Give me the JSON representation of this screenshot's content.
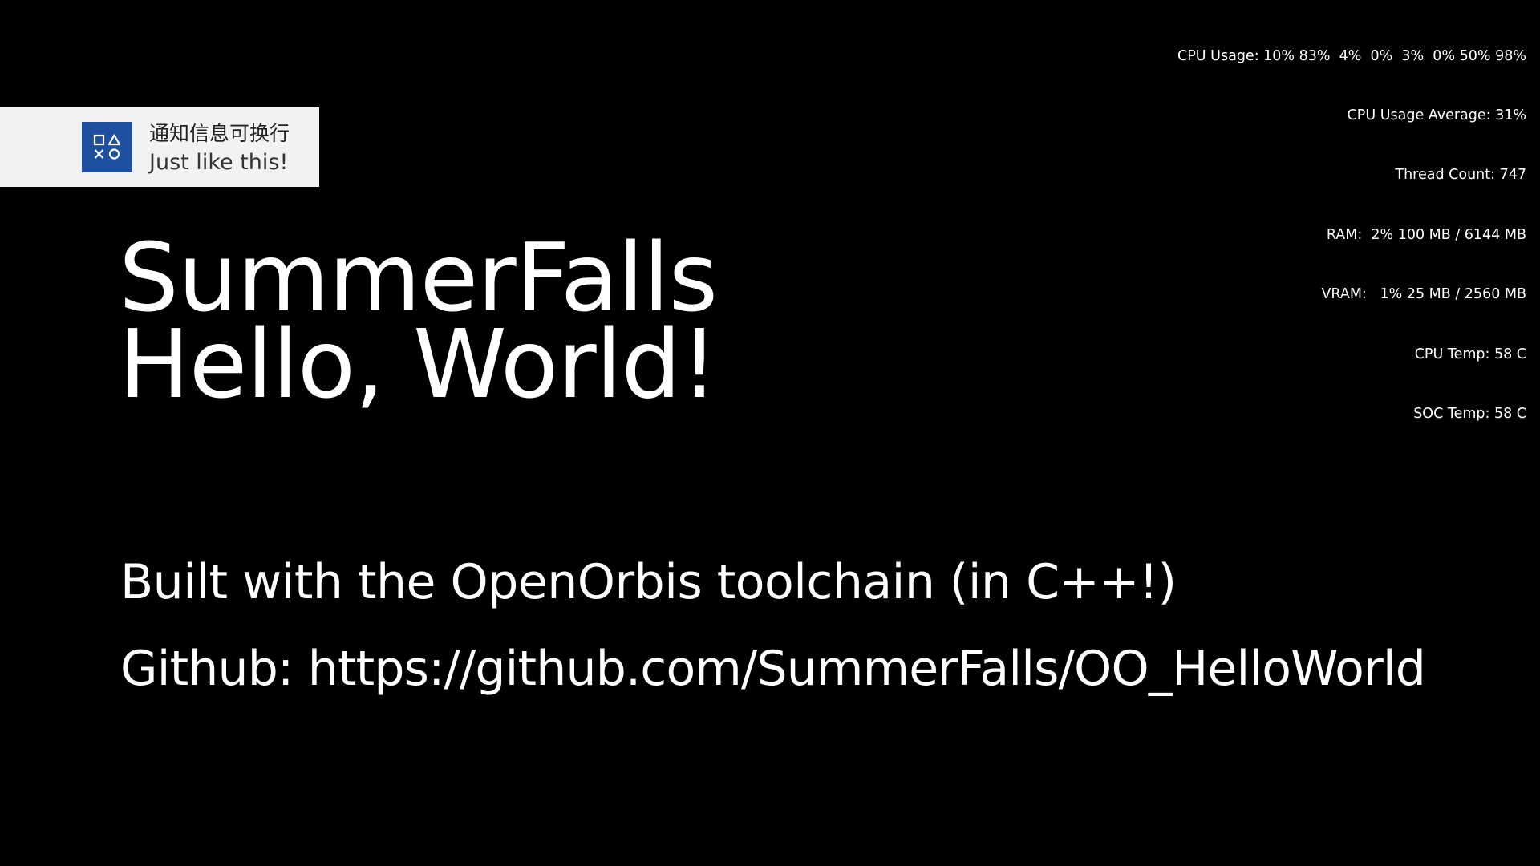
{
  "stats": {
    "cpu_usage": "CPU Usage: 10% 83%  4%  0%  3%  0% 50% 98%",
    "cpu_usage_average": "CPU Usage Average: 31%",
    "thread_count": "Thread Count: 747",
    "ram": "RAM:  2% 100 MB / 6144 MB",
    "vram": "VRAM:   1% 25 MB / 2560 MB",
    "cpu_temp": "CPU Temp: 58 C",
    "soc_temp": "SOC Temp: 58 C"
  },
  "notification": {
    "icon": "playstation-shapes-icon",
    "title": "通知信息可换行",
    "body": "Just like this!",
    "background_color": "#f2f2f2",
    "icon_color": "#1e4fa0"
  },
  "main": {
    "title_line1": "SummerFalls",
    "title_line2": "Hello, World!",
    "built_with": "Built with the OpenOrbis toolchain (in C++!)",
    "github": "Github: https://github.com/SummerFalls/OO_HelloWorld"
  },
  "colors": {
    "background": "#000000",
    "text": "#ffffff"
  }
}
